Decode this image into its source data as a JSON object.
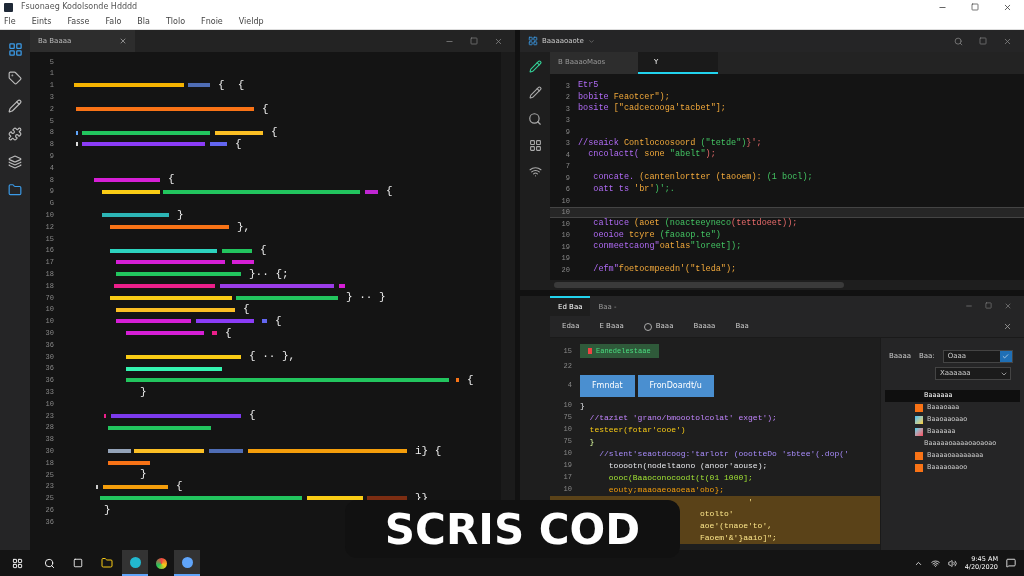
{
  "window": {
    "title": "Fsuonaeg Kodolsonde Hdddd"
  },
  "menu": [
    "Fle",
    "Eints",
    "Fasse",
    "Falo",
    "Bla",
    "Tlolo",
    "Fnoie",
    "Vieldp"
  ],
  "left_editor": {
    "tab": "Ba Baaaa",
    "rows": [
      {
        "number": "5",
        "tail": ""
      },
      {
        "number": "1",
        "tail": ""
      },
      {
        "number": "1",
        "tail": "{  {"
      },
      {
        "number": "3",
        "tail": ""
      },
      {
        "number": "2",
        "tail": "{"
      },
      {
        "number": "5",
        "tail": ""
      },
      {
        "number": "8",
        "tail": "{"
      },
      {
        "number": "8",
        "tail": "{"
      },
      {
        "number": "9",
        "tail": ""
      },
      {
        "number": "4",
        "tail": ""
      },
      {
        "number": "8",
        "tail": "{"
      },
      {
        "number": "9",
        "tail": "{"
      },
      {
        "number": "G",
        "tail": ""
      },
      {
        "number": "10",
        "tail": "}"
      },
      {
        "number": "12",
        "tail": "},"
      },
      {
        "number": "15",
        "tail": ""
      },
      {
        "number": "16",
        "tail": "{"
      },
      {
        "number": "17",
        "tail": ""
      },
      {
        "number": "18",
        "tail": "}·· {;"
      },
      {
        "number": "18",
        "tail": ""
      },
      {
        "number": "70",
        "tail": "} ·· }"
      },
      {
        "number": "10",
        "tail": "{"
      },
      {
        "number": "10",
        "tail": "{"
      },
      {
        "number": "30",
        "tail": "{"
      },
      {
        "number": "36",
        "tail": ""
      },
      {
        "number": "30",
        "tail": "{ ·· },"
      },
      {
        "number": "36",
        "tail": ""
      },
      {
        "number": "36",
        "tail": "{"
      },
      {
        "number": "33",
        "tail": "}"
      },
      {
        "number": "10",
        "tail": ""
      },
      {
        "number": "23",
        "tail": "{"
      },
      {
        "number": "28",
        "tail": ""
      },
      {
        "number": "38",
        "tail": ""
      },
      {
        "number": "30",
        "tail": "i} {"
      },
      {
        "number": "18",
        "tail": ""
      },
      {
        "number": "25",
        "tail": "}"
      },
      {
        "number": "23",
        "tail": "{"
      },
      {
        "number": "25",
        "tail": "}}"
      },
      {
        "number": "26",
        "tail": "}"
      },
      {
        "number": "36",
        "tail": ""
      }
    ]
  },
  "right_editor": {
    "title": "Baaaaoaote",
    "tabs": [
      {
        "label": "B BaaaoMaos",
        "selected": false
      },
      {
        "label": "Y",
        "selected": true
      }
    ],
    "lines": [
      {
        "number": "3",
        "current": false,
        "tokens": [
          "Etr5"
        ]
      },
      {
        "number": "2",
        "current": false,
        "tokens": [
          "bobite",
          " Feaotcer\");"
        ]
      },
      {
        "number": "3",
        "current": false,
        "tokens": [
          "bosite",
          " [\"cadcecooga'tacbet\"];"
        ]
      },
      {
        "number": "3",
        "current": false
      },
      {
        "number": "9",
        "current": false
      },
      {
        "number": "3",
        "current": false,
        "tokens": [
          "//seaick",
          " Contlocoosoord",
          " (\"tetde\")",
          "}';"
        ]
      },
      {
        "number": "4",
        "current": false,
        "tokens": [
          "  cncolactt(",
          " sone",
          " \"abelt\"",
          ");"
        ]
      },
      {
        "number": "7",
        "current": false
      },
      {
        "number": "9",
        "current": false,
        "tokens": [
          "   concate.",
          " (cantenlortter (taooem):",
          " (1 bocl);"
        ]
      },
      {
        "number": "6",
        "current": false,
        "tokens": [
          "   oatt ts",
          " 'br'",
          ")';."
        ]
      },
      {
        "number": "10",
        "current": false
      },
      {
        "number": "10",
        "current": true
      },
      {
        "number": "10",
        "current": false,
        "tokens": [
          "   caltuce",
          " (aoet",
          " (noacteeyneco",
          "(tettdoeet));"
        ]
      },
      {
        "number": "10",
        "current": false,
        "tokens": [
          "   oeoioe",
          " tcyre",
          " (faoaop.te\")"
        ]
      },
      {
        "number": "19",
        "current": false,
        "tokens": [
          "   conmeetcaong\"",
          "oatlas",
          "\"loreet]);"
        ]
      },
      {
        "number": "19",
        "current": false
      },
      {
        "number": "20",
        "current": false,
        "tokens": [
          "   /efm\"",
          "foetocmpeedn'(\"tleda\");"
        ]
      }
    ]
  },
  "bottom_panel": {
    "tabs": [
      {
        "label": "Ed Baa",
        "selected": true
      },
      {
        "label": "Baa -",
        "selected": false
      }
    ],
    "toolbar": [
      {
        "kind": "text",
        "label": "Edaa"
      },
      {
        "kind": "text",
        "label": "E Baaa"
      },
      {
        "kind": "radio",
        "label": "Baaa"
      },
      {
        "kind": "text",
        "label": "Baaaa"
      },
      {
        "kind": "text",
        "label": "Baa"
      }
    ],
    "lines": [
      {
        "number": "15",
        "kind": "green-button",
        "text": "Eanedelestaae"
      },
      {
        "number": "22",
        "kind": "blank"
      },
      {
        "number": "4",
        "kind": "blue-buttons",
        "buttons": [
          "Fmndat",
          "FronDoardt/u"
        ]
      },
      {
        "number": "10",
        "kind": "code",
        "text": "}",
        "highlight": false
      },
      {
        "number": "75",
        "kind": "code",
        "text": "  //taziet 'grano/bmoootolcolat' exget');",
        "highlight": false
      },
      {
        "number": "10",
        "kind": "code",
        "text": "  testeer(fotar'cooe')",
        "highlight": false
      },
      {
        "number": "75",
        "kind": "code",
        "text": "  }",
        "highlight": false
      },
      {
        "number": "10",
        "kind": "code",
        "text": "    //slent'seaotdcoog:'tarlotr (oootteDo 'sbtee'(.dop('",
        "highlight": false
      },
      {
        "number": "19",
        "kind": "code",
        "text": "      tooootn(nodeltaono (anoor'aouse);",
        "highlight": false
      },
      {
        "number": "17",
        "kind": "code",
        "text": "      oooc(Baaoconocoodt(t(01 1000];",
        "highlight": false
      },
      {
        "number": "10",
        "kind": "code",
        "text": "      eouty;maaoaeoaoeaa'obo};",
        "highlight": false
      },
      {
        "kind": "tail",
        "text": "          '",
        "highlight": true
      },
      {
        "kind": "tail",
        "text": "otolto'",
        "highlight": true
      },
      {
        "kind": "tail",
        "text": "aoe'(tnaoe'to',",
        "highlight": true
      },
      {
        "kind": "tail",
        "text": "Faoem'&'}aaio]\";",
        "highlight": true
      }
    ],
    "side": {
      "label": "Baaaa",
      "field_label": "Baa:",
      "field_value": "Oaaa",
      "dropdown_value": "Xaaaaaa",
      "items": [
        {
          "label": "Baaaaaa",
          "selected": true
        },
        {
          "label": "Baaaoaaa",
          "selected": false
        },
        {
          "label": "Baaoaaoaao",
          "selected": false
        },
        {
          "label": "Baaaaaa",
          "selected": false
        },
        {
          "label": "Baaaaaoaaaaoaoaoao",
          "selected": false
        },
        {
          "label": "Baaaaoaaaaaaaa",
          "selected": false
        },
        {
          "label": "Baaaaoaaoo",
          "selected": false
        }
      ]
    }
  },
  "taskbar": {
    "time": "9:45 AM",
    "date": "4/20/2020"
  },
  "caption": "SCRIS COD"
}
